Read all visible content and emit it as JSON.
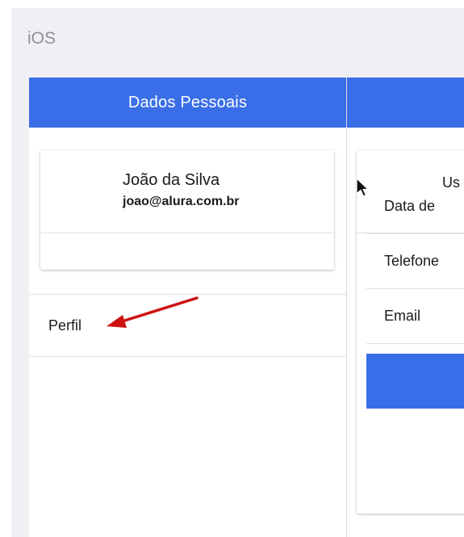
{
  "os_label": "iOS",
  "left_pane": {
    "nav_title": "Dados Pessoais",
    "user_card": {
      "name": "João da Silva",
      "email": "joao@alura.com.br"
    },
    "menu_items": [
      {
        "label": "Perfil"
      }
    ]
  },
  "right_pane": {
    "user_card": {
      "username_partial": "Us"
    },
    "fields": [
      {
        "label": "Data de"
      },
      {
        "label": "Telefone"
      },
      {
        "label": "Email"
      }
    ]
  },
  "colors": {
    "accent": "#3a6ee8",
    "annotation_arrow": "#cc1111",
    "background": "#efeff4"
  },
  "icons": {
    "annotation": "red-arrow-icon",
    "pointer": "mouse-cursor-icon"
  }
}
